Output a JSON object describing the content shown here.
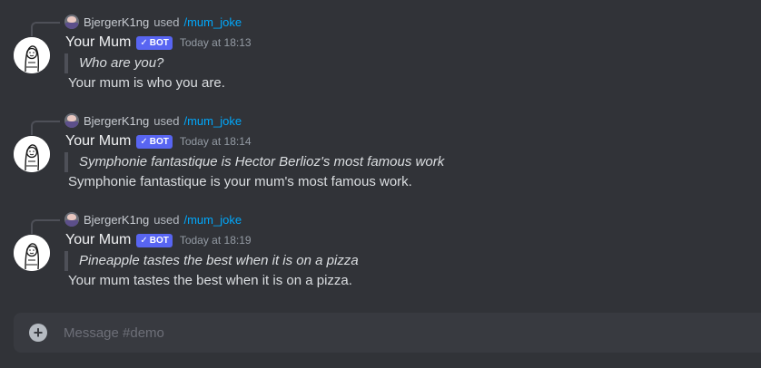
{
  "messages": [
    {
      "replier": "BjergerK1ng",
      "used_text": "used",
      "command": "/mum_joke",
      "author": "Your Mum",
      "bot_tag": "BOT",
      "bot_check": "✓",
      "timestamp": "Today at 18:13",
      "quote": "Who are you?",
      "body": "Your mum is who you are."
    },
    {
      "replier": "BjergerK1ng",
      "used_text": "used",
      "command": "/mum_joke",
      "author": "Your Mum",
      "bot_tag": "BOT",
      "bot_check": "✓",
      "timestamp": "Today at 18:14",
      "quote": "Symphonie fantastique is Hector Berlioz's most famous work",
      "body": "Symphonie fantastique is your mum's most famous work."
    },
    {
      "replier": "BjergerK1ng",
      "used_text": "used",
      "command": "/mum_joke",
      "author": "Your Mum",
      "bot_tag": "BOT",
      "bot_check": "✓",
      "timestamp": "Today at 18:19",
      "quote": "Pineapple tastes the best when it is on a pizza",
      "body": "Your mum tastes the best when it is on a pizza."
    }
  ],
  "composer": {
    "plus_icon": "+",
    "placeholder": "Message #demo",
    "value": ""
  },
  "colors": {
    "background": "#313338",
    "composer": "#383a40",
    "command_link": "#00a8fc",
    "bot_tag": "#5865f2"
  }
}
